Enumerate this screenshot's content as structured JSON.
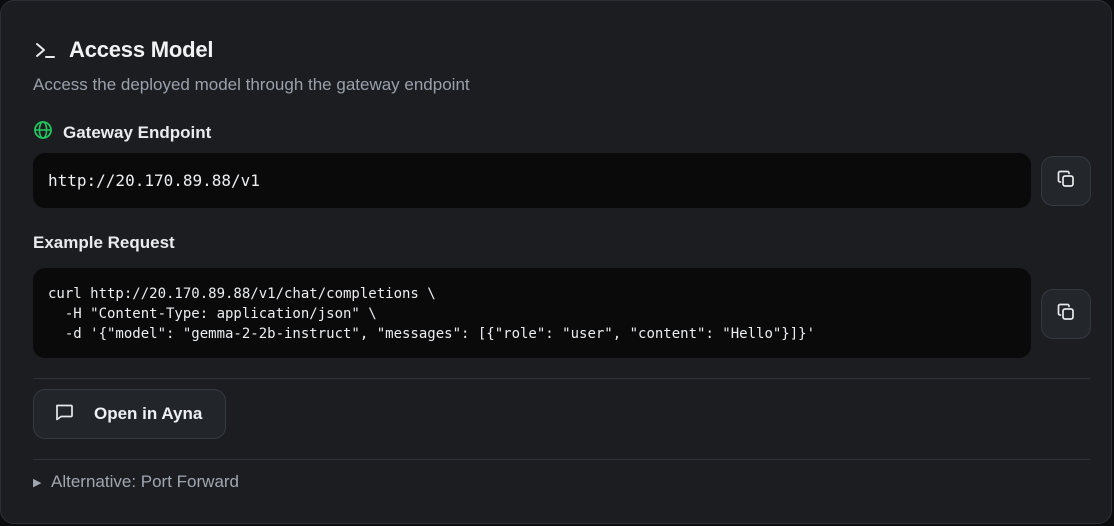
{
  "header": {
    "title": "Access Model",
    "subtitle": "Access the deployed model through the gateway endpoint",
    "icon": "terminal-icon"
  },
  "endpoint": {
    "label": "Gateway Endpoint",
    "icon": "globe-icon",
    "icon_color": "#22c55e",
    "url": "http://20.170.89.88/v1",
    "copy_icon": "copy-icon"
  },
  "example": {
    "label": "Example Request",
    "lines": [
      "curl http://20.170.89.88/v1/chat/completions \\",
      "  -H \"Content-Type: application/json\" \\",
      "  -d '{\"model\": \"gemma-2-2b-instruct\", \"messages\": [{\"role\": \"user\", \"content\": \"Hello\"}]}'"
    ],
    "copy_icon": "copy-icon"
  },
  "actions": {
    "open_label": "Open in Ayna",
    "open_icon": "chat-bubble-icon"
  },
  "alternative": {
    "label": "Alternative: Port Forward",
    "icon": "triangle-right-icon"
  }
}
